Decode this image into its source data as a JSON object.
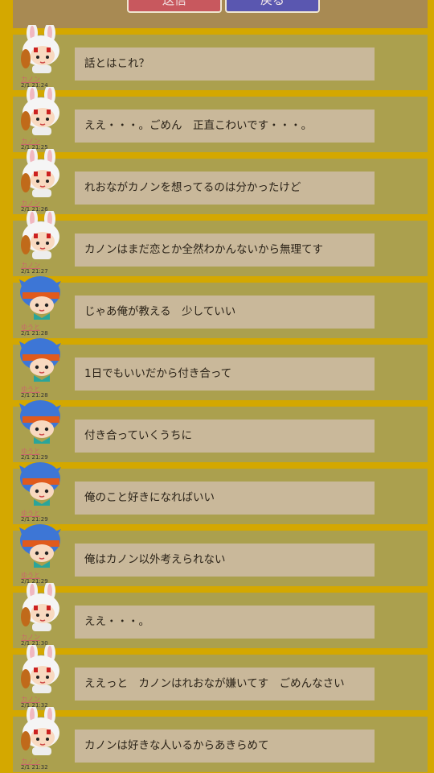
{
  "header": {
    "send_label": "送信",
    "back_label": "戻る"
  },
  "messages": [
    {
      "speaker": "カノン",
      "time": "2/1 21:24",
      "text": "話とはこれ？",
      "avatar": "rabbit-girl-avatar"
    },
    {
      "speaker": "カノン",
      "time": "2/1 21:25",
      "text": "ええ・・・。ごめん　正直こわいです・・・。",
      "avatar": "rabbit-girl-avatar"
    },
    {
      "speaker": "カノン",
      "time": "2/1 21:26",
      "text": "れおながカノンを想ってるのは分かったけど",
      "avatar": "rabbit-girl-avatar"
    },
    {
      "speaker": "カノン",
      "time": "2/1 21:27",
      "text": "カノンはまだ恋とか全然わかんないから無理てす",
      "avatar": "rabbit-girl-avatar"
    },
    {
      "speaker": "ゆうと",
      "time": "2/1 21:28",
      "text": "じゃあ俺が教える　少していい",
      "avatar": "blue-hair-boy-avatar"
    },
    {
      "speaker": "ゆうと",
      "time": "2/1 21:28",
      "text": "1日でもいいだから付き合って",
      "avatar": "blue-hair-boy-avatar"
    },
    {
      "speaker": "ゆうと",
      "time": "2/1 21:29",
      "text": "付き合っていくうちに",
      "avatar": "blue-hair-boy-avatar"
    },
    {
      "speaker": "ゆうと",
      "time": "2/1 21:29",
      "text": "俺のこと好きになればいい",
      "avatar": "blue-hair-boy-avatar"
    },
    {
      "speaker": "ゆうと",
      "time": "2/1 21:29",
      "text": "俺はカノン以外考えられない",
      "avatar": "blue-hair-boy-avatar"
    },
    {
      "speaker": "カノン",
      "time": "2/1 21:30",
      "text": "ええ・・・。",
      "avatar": "rabbit-girl-avatar"
    },
    {
      "speaker": "カノン",
      "time": "2/1 21:32",
      "text": "ええっと　カノンはれおなが嫌いてす　ごめんなさい",
      "avatar": "rabbit-girl-avatar"
    },
    {
      "speaker": "カノン",
      "time": "2/1 21:32",
      "text": "カノンは好きな人いるからあきらめて",
      "avatar": "rabbit-girl-avatar"
    }
  ]
}
